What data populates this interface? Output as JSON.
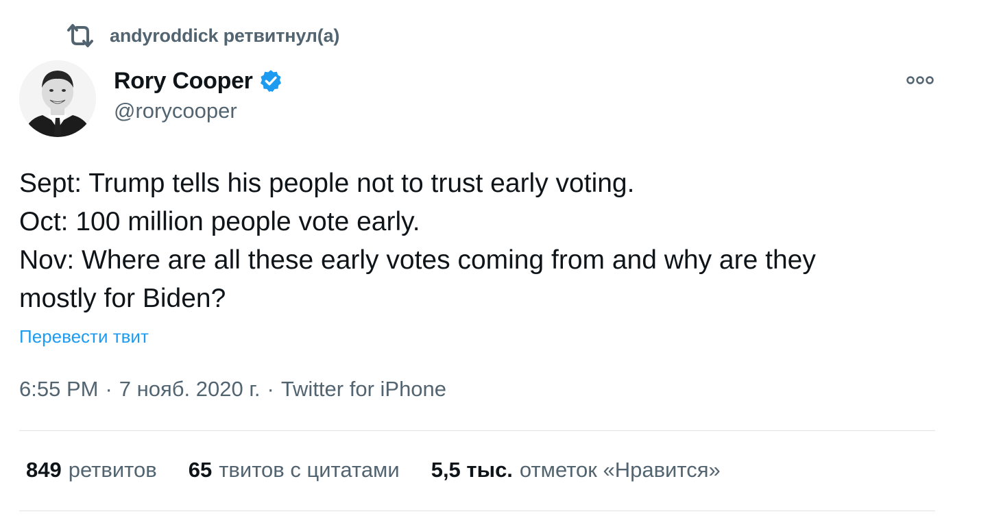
{
  "retweet_context": {
    "icon": "retweet-icon",
    "text": "andyroddick ретвитнул(а)"
  },
  "author": {
    "display_name": "Rory Cooper",
    "handle": "@rorycooper",
    "verified": true,
    "verified_color": "#1d9bf0",
    "avatar": "avatar-photo"
  },
  "more_icon": "more-options-icon",
  "tweet": {
    "lines": [
      "Sept: Trump tells his people not to trust early voting.",
      "Oct: 100 million people vote early.",
      "Nov: Where are all these early votes coming from and why are they",
      "mostly for Biden?"
    ],
    "translate_label": "Перевести твит"
  },
  "meta": {
    "time": "6:55 PM",
    "date": "7 нояб. 2020 г.",
    "source": "Twitter for iPhone",
    "separator": "·"
  },
  "stats": [
    {
      "count": "849",
      "label": "ретвитов"
    },
    {
      "count": "65",
      "label": "твитов с цитатами"
    },
    {
      "count": "5,5 тыс.",
      "label": "отметок «Нравится»"
    }
  ],
  "colors": {
    "text": "#0f1419",
    "secondary": "#536471",
    "link": "#1d9bf0",
    "divider": "#dfe3e6"
  }
}
